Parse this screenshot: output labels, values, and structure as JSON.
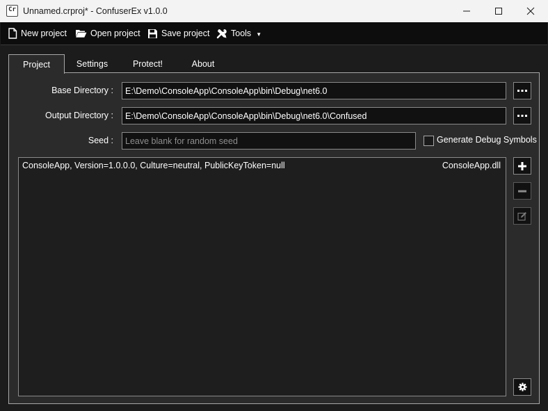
{
  "window": {
    "title": "Unnamed.crproj* - ConfuserEx v1.0.0",
    "app_icon_text": "Cr",
    "controls": [
      "minimize-icon",
      "maximize-icon",
      "close-icon"
    ]
  },
  "toolbar": {
    "new_project": "New project",
    "open_project": "Open project",
    "save_project": "Save project",
    "tools": "Tools",
    "tools_caret": "▼"
  },
  "tabs": [
    {
      "label": "Project",
      "active": true
    },
    {
      "label": "Settings",
      "active": false
    },
    {
      "label": "Protect!",
      "active": false
    },
    {
      "label": "About",
      "active": false
    }
  ],
  "project": {
    "base_directory_label": "Base Directory :",
    "base_directory_value": "E:\\Demo\\ConsoleApp\\ConsoleApp\\bin\\Debug\\net6.0",
    "output_directory_label": "Output Directory :",
    "output_directory_value": "E:\\Demo\\ConsoleApp\\ConsoleApp\\bin\\Debug\\net6.0\\Confused",
    "seed_label": "Seed :",
    "seed_placeholder": "Leave blank for random seed",
    "seed_value": "",
    "debug_symbols_label": "Generate Debug Symbols",
    "debug_symbols_checked": false,
    "modules": [
      {
        "assembly": "ConsoleApp, Version=1.0.0.0, Culture=neutral, PublicKeyToken=null",
        "file": "ConsoleApp.dll"
      }
    ],
    "side_buttons": [
      "add-icon",
      "remove-icon",
      "edit-icon",
      "settings-icon"
    ]
  },
  "colors": {
    "titlebar_bg": "#f3f3f3",
    "toolbar_bg": "#0d0d0d",
    "window_bg": "#1c1c1c",
    "panel_bg": "#2b2b2b",
    "input_bg": "#111111",
    "border": "#8a8a8a",
    "text": "#ffffff",
    "placeholder_text": "#8e8e8e"
  }
}
